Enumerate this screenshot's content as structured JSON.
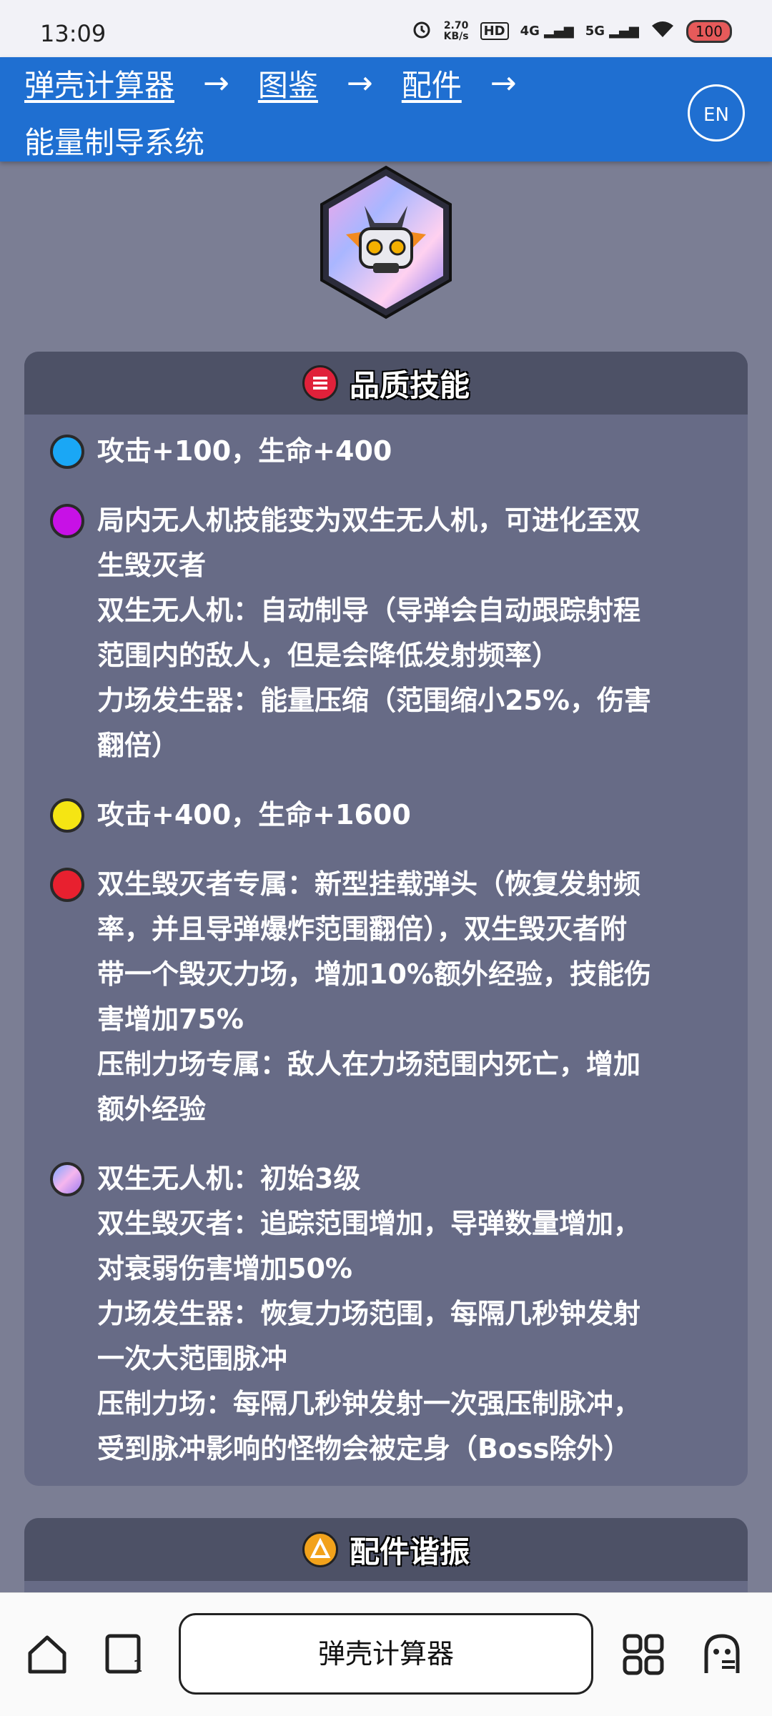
{
  "status_bar": {
    "time": "13:09",
    "net_speed_value": "2.70",
    "net_speed_unit": "KB/s",
    "hd": "HD",
    "sig1": "4G",
    "sig2": "5G",
    "battery": "100"
  },
  "header": {
    "breadcrumb": [
      "弹壳计算器",
      "图鉴",
      "配件"
    ],
    "arrow": "→",
    "title": "能量制导系统",
    "lang_button": "EN"
  },
  "quality_card": {
    "title": "品质技能",
    "skills": [
      {
        "color": "#1aa7f5",
        "lines": [
          "攻击+100，生命+400"
        ]
      },
      {
        "color": "#c711e6",
        "lines": [
          "局内无人机技能变为双生无人机，可进化至双",
          "生毁灭者",
          "双生无人机：自动制导（导弹会自动跟踪射程",
          "范围内的敌人，但是会降低发射频率）",
          "力场发生器：能量压缩（范围缩小25%，伤害",
          "翻倍）"
        ]
      },
      {
        "color": "#f5e513",
        "lines": [
          "攻击+400，生命+1600"
        ]
      },
      {
        "color": "#e8202f",
        "lines": [
          "双生毁灭者专属：新型挂载弹头（恢复发射频",
          "率，并且导弹爆炸范围翻倍），双生毁灭者附",
          "带一个毁灭力场，增加10%额外经验，技能伤",
          "害增加75%",
          "压制力场专属：敌人在力场范围内死亡，增加",
          "额外经验"
        ]
      },
      {
        "color": "gradient",
        "lines": [
          "双生无人机：初始3级",
          "双生毁灭者：追踪范围增加，导弹数量增加，",
          "对衰弱伤害增加50%",
          "力场发生器：恢复力场范围，每隔几秒钟发射",
          "一次大范围脉冲",
          "压制力场：每隔几秒钟发射一次强压制脉冲，",
          "受到脉冲影响的怪物会被定身（Boss除外）"
        ]
      }
    ]
  },
  "resonance_card": {
    "title": "配件谐振"
  },
  "bottom_nav": {
    "center_label": "弹壳计算器"
  },
  "colors": {
    "header": "#1f6fd1",
    "background": "#7b7e94",
    "card": "#676b86"
  }
}
